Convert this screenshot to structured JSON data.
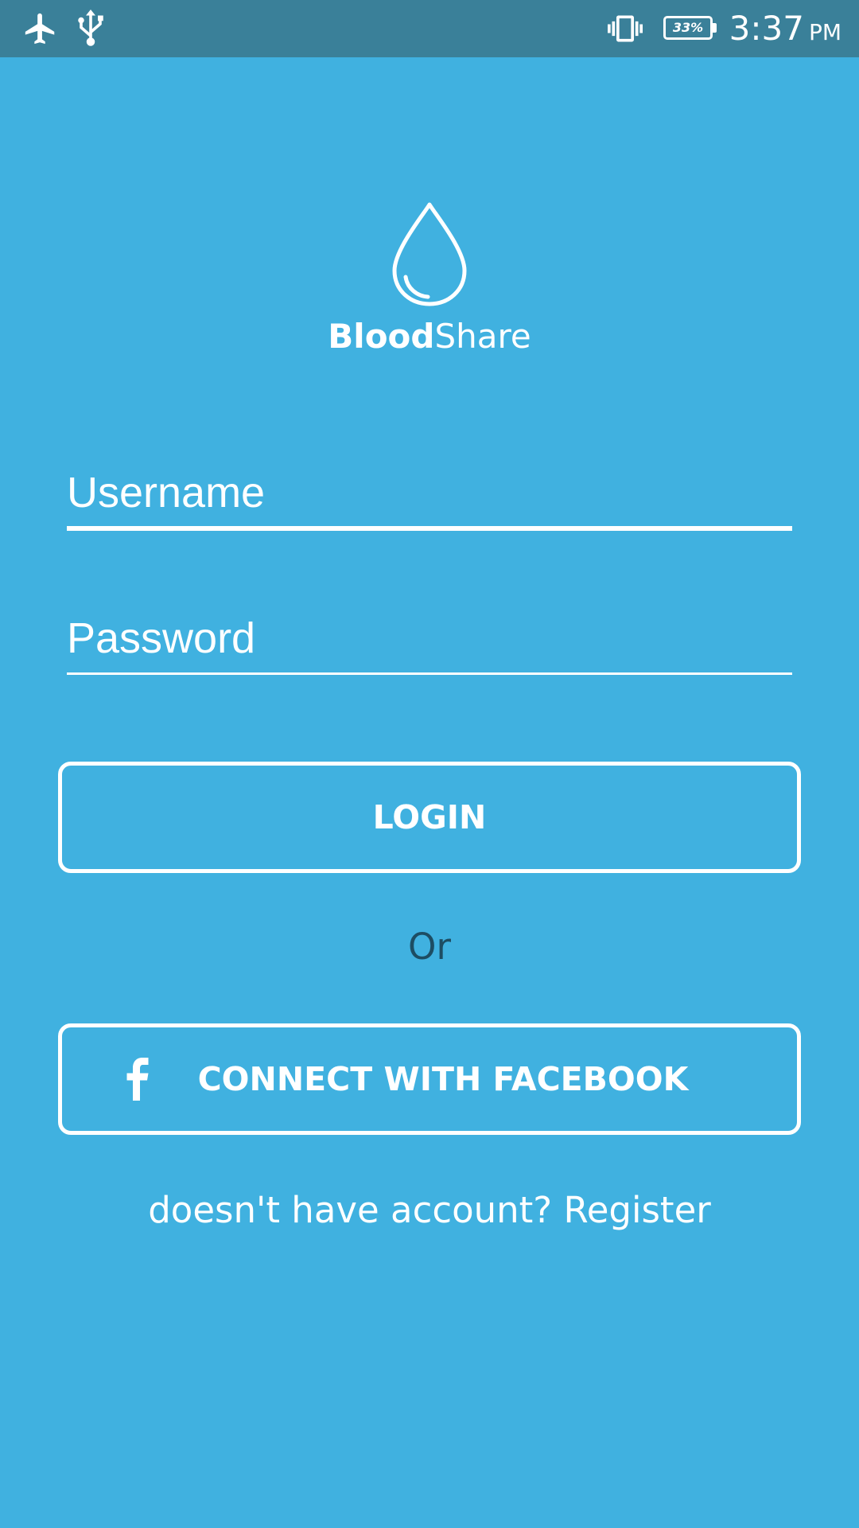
{
  "status_bar": {
    "icons": [
      "airplane-mode-icon",
      "usb-icon",
      "vibrate-icon",
      "battery-icon"
    ],
    "battery_percent": "33%",
    "time": "3:37",
    "ampm": "PM",
    "bar_color": "#3a8099"
  },
  "app": {
    "logo_icon": "blood-drop-icon",
    "brand_bold": "Blood",
    "brand_light": "Share",
    "background_color": "#40b1e0"
  },
  "form": {
    "username_placeholder": "Username",
    "password_placeholder": "Password"
  },
  "buttons": {
    "login_label": "LOGIN",
    "or_label": "Or",
    "facebook_label": "CONNECT WITH FACEBOOK",
    "facebook_icon": "facebook-f-icon"
  },
  "footer": {
    "register_text": "doesn't have account? Register"
  }
}
